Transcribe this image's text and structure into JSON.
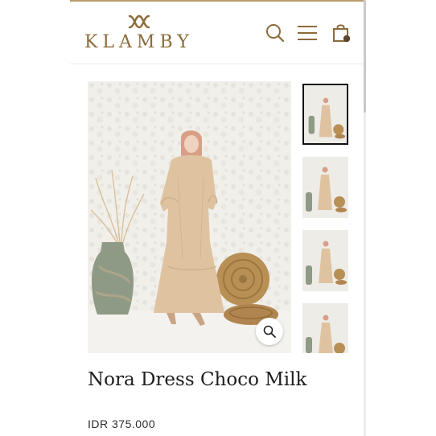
{
  "brand": {
    "name": "KLAMBY",
    "accent": "#8c6b3b"
  },
  "header": {
    "icons": [
      "search-icon",
      "menu-icon",
      "shopping-bag-icon"
    ]
  },
  "gallery": {
    "main_image": "photo-woman-beige-maxi-dress",
    "thumbnail_count": 4,
    "active_thumbnail": 1,
    "zoom_icon": "zoom-icon"
  },
  "product": {
    "title": "Nora Dress Choco Milk",
    "price": "IDR 375.000"
  }
}
